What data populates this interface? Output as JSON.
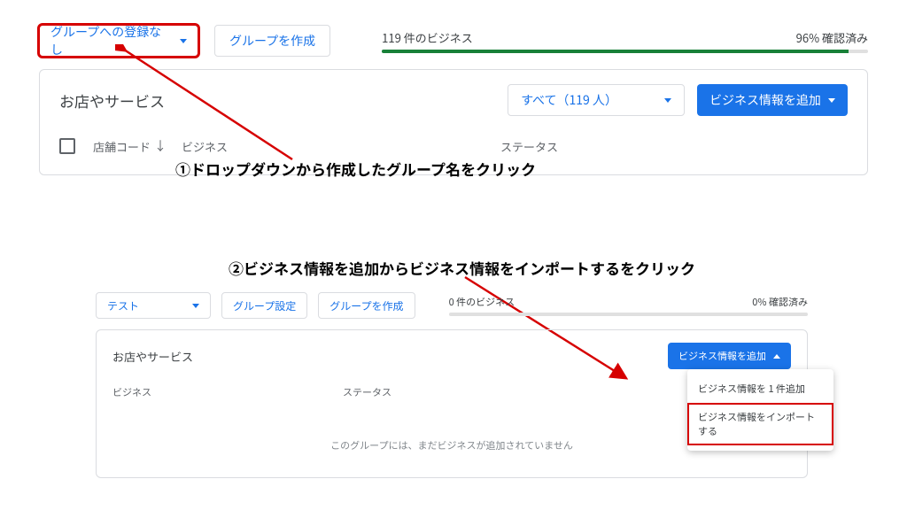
{
  "top": {
    "group_dropdown": "グループへの登録なし",
    "create_group": "グループを作成",
    "count_label": "119 件のビジネス",
    "verified_label": "96% 確認済み",
    "progress_pct": 96
  },
  "panel1": {
    "title": "お店やサービス",
    "filter_label": "すべて（119 人）",
    "add_button": "ビジネス情報を追加",
    "col_store": "店舗コード",
    "col_business": "ビジネス",
    "col_status": "ステータス"
  },
  "annotation1": "①ドロップダウンから作成したグループ名をクリック",
  "annotation2": "②ビジネス情報を追加からビジネス情報をインポートするをクリック",
  "mini": {
    "group_dropdown": "テスト",
    "group_settings": "グループ設定",
    "create_group": "グループを作成",
    "count_label": "0 件のビジネス",
    "verified_label": "0% 確認済み",
    "progress_pct": 0,
    "title": "お店やサービス",
    "add_button": "ビジネス情報を追加",
    "menu_add_one": "ビジネス情報を 1 件追加",
    "menu_import": "ビジネス情報をインポートする",
    "col_business": "ビジネス",
    "col_status": "ステータス",
    "empty": "このグループには、まだビジネスが追加されていません"
  }
}
